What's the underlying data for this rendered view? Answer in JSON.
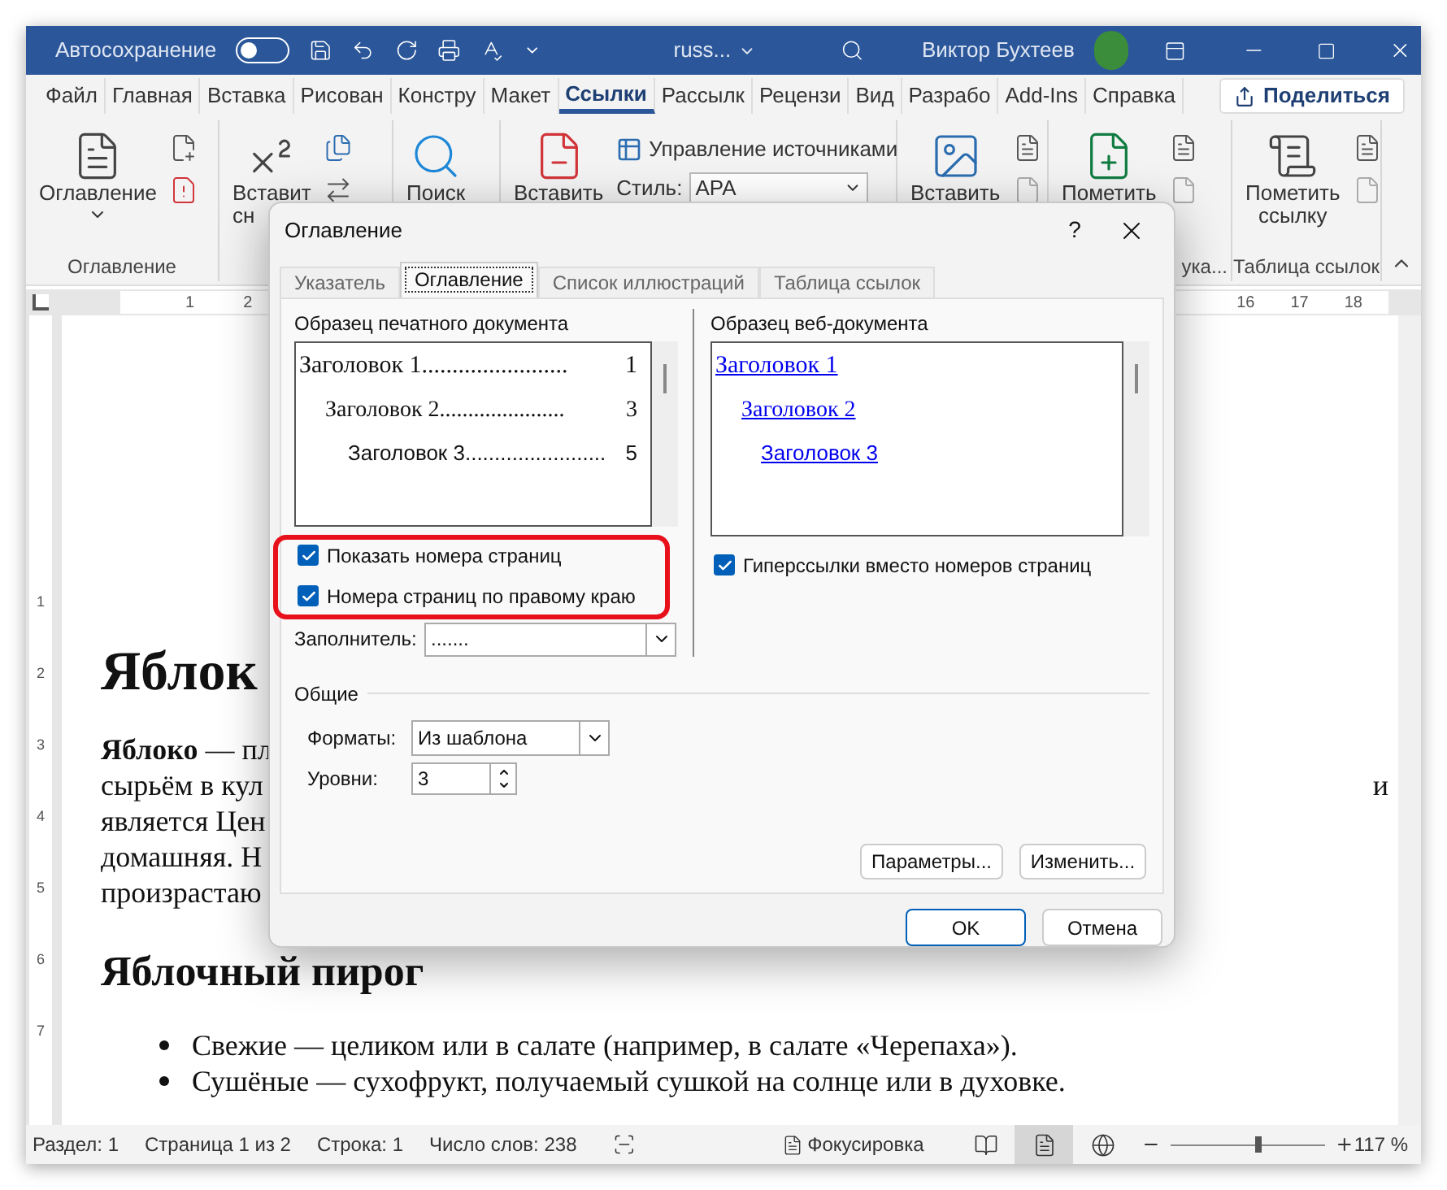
{
  "title_bar": {
    "autosave_label": "Автосохранение",
    "autosave_on": false,
    "doc_name": "russ...",
    "user": "Виктор Бухтеев"
  },
  "menu_tabs": [
    {
      "label": "Файл",
      "selected": false
    },
    {
      "label": "Главная",
      "selected": false
    },
    {
      "label": "Вставка",
      "selected": false
    },
    {
      "label": "Рисован",
      "selected": false
    },
    {
      "label": "Констру",
      "selected": false
    },
    {
      "label": "Макет",
      "selected": false
    },
    {
      "label": "Ссылки",
      "selected": true
    },
    {
      "label": "Рассылк",
      "selected": false
    },
    {
      "label": "Рецензи",
      "selected": false
    },
    {
      "label": "Вид",
      "selected": false
    },
    {
      "label": "Разрабо",
      "selected": false
    },
    {
      "label": "Add-Ins",
      "selected": false
    },
    {
      "label": "Справка",
      "selected": false
    }
  ],
  "share_button": "Поделиться",
  "ribbon_groups": [
    {
      "kind": "toc",
      "lines": [
        "Оглавление"
      ],
      "dropdown": true,
      "label": "Оглавление"
    },
    {
      "kind": "footnote",
      "lines": [
        "Вставит",
        "сн"
      ]
    },
    {
      "kind": "search",
      "lines": [
        "Поиск"
      ]
    },
    {
      "kind": "citation",
      "lines": [
        "Вставить"
      ],
      "manage": "Управление источниками",
      "style_label": "Стиль:",
      "style_value": "APA"
    },
    {
      "kind": "caption",
      "lines": [
        "Вставить"
      ]
    },
    {
      "kind": "mark_entry",
      "lines": [
        "Пометить"
      ],
      "label": "ука..."
    },
    {
      "kind": "mark_citation",
      "lines": [
        "Пометить",
        "ссылку"
      ],
      "label": "Таблица ссылок"
    }
  ],
  "ruler": {
    "left_marks": [
      "1",
      "2"
    ],
    "right_marks": [
      "16",
      "17",
      "18"
    ]
  },
  "vertical_ruler": [
    "1",
    "2",
    "3",
    "4",
    "5",
    "6",
    "7"
  ],
  "document": {
    "heading": "Яблок",
    "paragraph_lines": [
      {
        "text": "**Яблоко** — пл"
      },
      {
        "text": "сырьём в кул",
        "end": "и"
      },
      {
        "text": "является Цен"
      },
      {
        "text": "домашняя. Н"
      },
      {
        "text": "произрастаю"
      }
    ],
    "heading2": "Яблочный пирог",
    "bullets": [
      "Свежие — целиком или в салате (например, в салате «Черепаха»).",
      "Сушёные — сухофрукт, получаемый сушкой на солнце или в духовке."
    ]
  },
  "dialog": {
    "title": "Оглавление",
    "help": "?",
    "tabs": [
      {
        "label": "Указатель",
        "selected": false
      },
      {
        "label": "Оглавление",
        "selected": true
      },
      {
        "label": "Список иллюстраций",
        "selected": false
      },
      {
        "label": "Таблица ссылок",
        "selected": false
      }
    ],
    "print_preview": {
      "label": "Образец печатного документа",
      "entries": [
        {
          "text": "Заголовок 1",
          "leader": "........................",
          "page": "1"
        },
        {
          "text": "Заголовок 2",
          "leader": "......................",
          "page": "3"
        },
        {
          "text": "Заголовок 3",
          "leader": "........................",
          "page": "5"
        }
      ]
    },
    "web_preview": {
      "label": "Образец веб-документа",
      "links": [
        "Заголовок 1",
        "Заголовок 2",
        "Заголовок 3"
      ]
    },
    "print_options": [
      {
        "label": "Показать номера страниц",
        "checked": true
      },
      {
        "label": "Номера страниц по правому краю",
        "checked": true
      }
    ],
    "highlight_print_options": true,
    "web_option": {
      "label": "Гиперссылки вместо номеров страниц",
      "checked": true
    },
    "leader_field": {
      "label": "Заполнитель:",
      "value": "......."
    },
    "general": {
      "title": "Общие",
      "formats": {
        "label": "Форматы:",
        "value": "Из шаблона"
      },
      "levels": {
        "label": "Уровни:",
        "value": "3"
      }
    },
    "buttons": {
      "options": "Параметры...",
      "modify": "Изменить...",
      "ok": "OK",
      "cancel": "Отмена"
    }
  },
  "status_bar": {
    "items": [
      "Раздел: 1",
      "Страница 1 из 2",
      "Строка: 1",
      "Число слов: 238"
    ],
    "focus": "Фокусировка",
    "views": [
      {
        "kind": "read",
        "selected": false
      },
      {
        "kind": "print",
        "selected": true
      },
      {
        "kind": "web",
        "selected": false
      }
    ],
    "zoom": {
      "level": 0.57,
      "reading": "117 %"
    }
  }
}
